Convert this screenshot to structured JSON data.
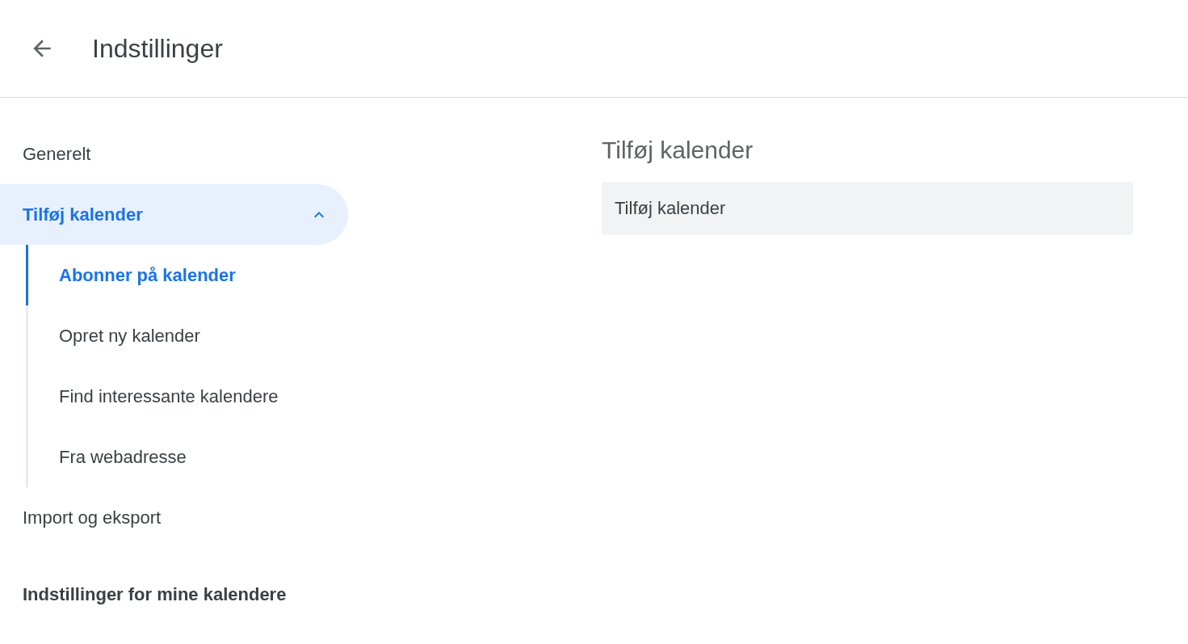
{
  "header": {
    "title": "Indstillinger"
  },
  "sidebar": {
    "items": [
      {
        "label": "Generelt",
        "selected": false
      },
      {
        "label": "Tilføj kalender",
        "selected": true,
        "expanded": true,
        "children": [
          {
            "label": "Abonner på kalender",
            "selected": true
          },
          {
            "label": "Opret ny kalender",
            "selected": false
          },
          {
            "label": "Find interessante kalendere",
            "selected": false
          },
          {
            "label": "Fra webadresse",
            "selected": false
          }
        ]
      },
      {
        "label": "Import og eksport",
        "selected": false
      }
    ],
    "section_heading": "Indstillinger for mine kalendere"
  },
  "main": {
    "heading": "Tilføj kalender",
    "panel": {
      "label": "Tilføj kalender"
    }
  }
}
